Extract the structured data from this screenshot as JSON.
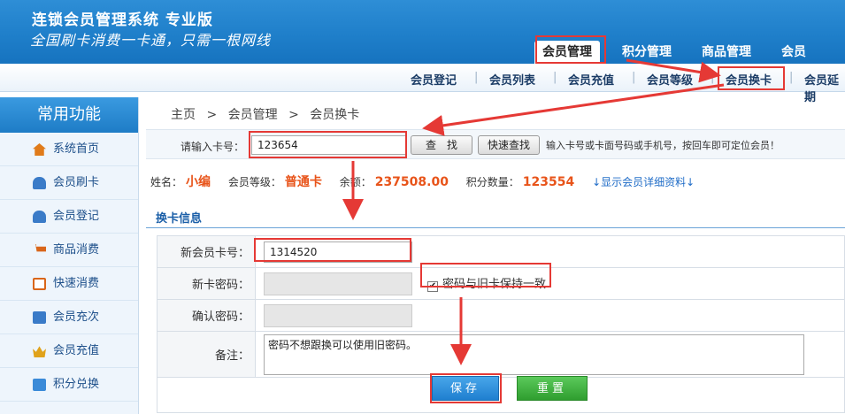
{
  "header": {
    "title": "连锁会员管理系统 专业版",
    "slogan": "全国刷卡消费一卡通，只需一根网线",
    "nav": [
      {
        "label": "会员管理",
        "active": true
      },
      {
        "label": "积分管理",
        "active": false
      },
      {
        "label": "商品管理",
        "active": false
      },
      {
        "label": "会员",
        "active": false
      }
    ]
  },
  "subnav": {
    "items": [
      "会员登记",
      "会员列表",
      "会员充值",
      "会员等级",
      "会员换卡",
      "会员延期"
    ],
    "active": "会员换卡"
  },
  "sidebar": {
    "title": "常用功能",
    "items": [
      {
        "label": "系统首页",
        "icon": "home-icon",
        "color": "#e07b1a"
      },
      {
        "label": "会员刷卡",
        "icon": "card-user-icon",
        "color": "#3a7bc8"
      },
      {
        "label": "会员登记",
        "icon": "users-icon",
        "color": "#3a7bc8"
      },
      {
        "label": "商品消费",
        "icon": "cart-icon",
        "color": "#d9661a"
      },
      {
        "label": "快速消费",
        "icon": "chart-icon",
        "color": "#d9661a"
      },
      {
        "label": "会员充次",
        "icon": "stack-icon",
        "color": "#3a7bc8"
      },
      {
        "label": "会员充值",
        "icon": "crown-icon",
        "color": "#e0a21a"
      },
      {
        "label": "积分兑换",
        "icon": "gift-icon",
        "color": "#3a8ad8"
      }
    ]
  },
  "breadcrumb": {
    "home": "主页",
    "sep": ">",
    "section": "会员管理",
    "page": "会员换卡"
  },
  "search": {
    "label": "请输入卡号：",
    "value": "123654",
    "search_btn": "查　找",
    "quick_btn": "快速查找",
    "hint": "输入卡号或卡面号码或手机号，按回车即可定位会员！"
  },
  "member": {
    "name_label": "姓名：",
    "name": "小编",
    "level_label": "会员等级：",
    "level": "普通卡",
    "balance_label": "余额：",
    "balance": "237508.00",
    "points_label": "积分数量：",
    "points": "123554",
    "details_link": "↓显示会员详细资料↓"
  },
  "form": {
    "section_title": "换卡信息",
    "new_card_label": "新会员卡号：",
    "new_card_value": "1314520",
    "new_pwd_label": "新卡密码：",
    "confirm_pwd_label": "确认密码：",
    "same_pwd_label": "密码与旧卡保持一致",
    "same_pwd_checked": "✔",
    "remark_label": "备注：",
    "remark_value": "密码不想跟换可以使用旧密码。",
    "save_btn": "保存",
    "reset_btn": "重置"
  },
  "colors": {
    "header": "#1f7fca",
    "accent_orange": "#e8541a",
    "annotation_red": "#e53935"
  }
}
